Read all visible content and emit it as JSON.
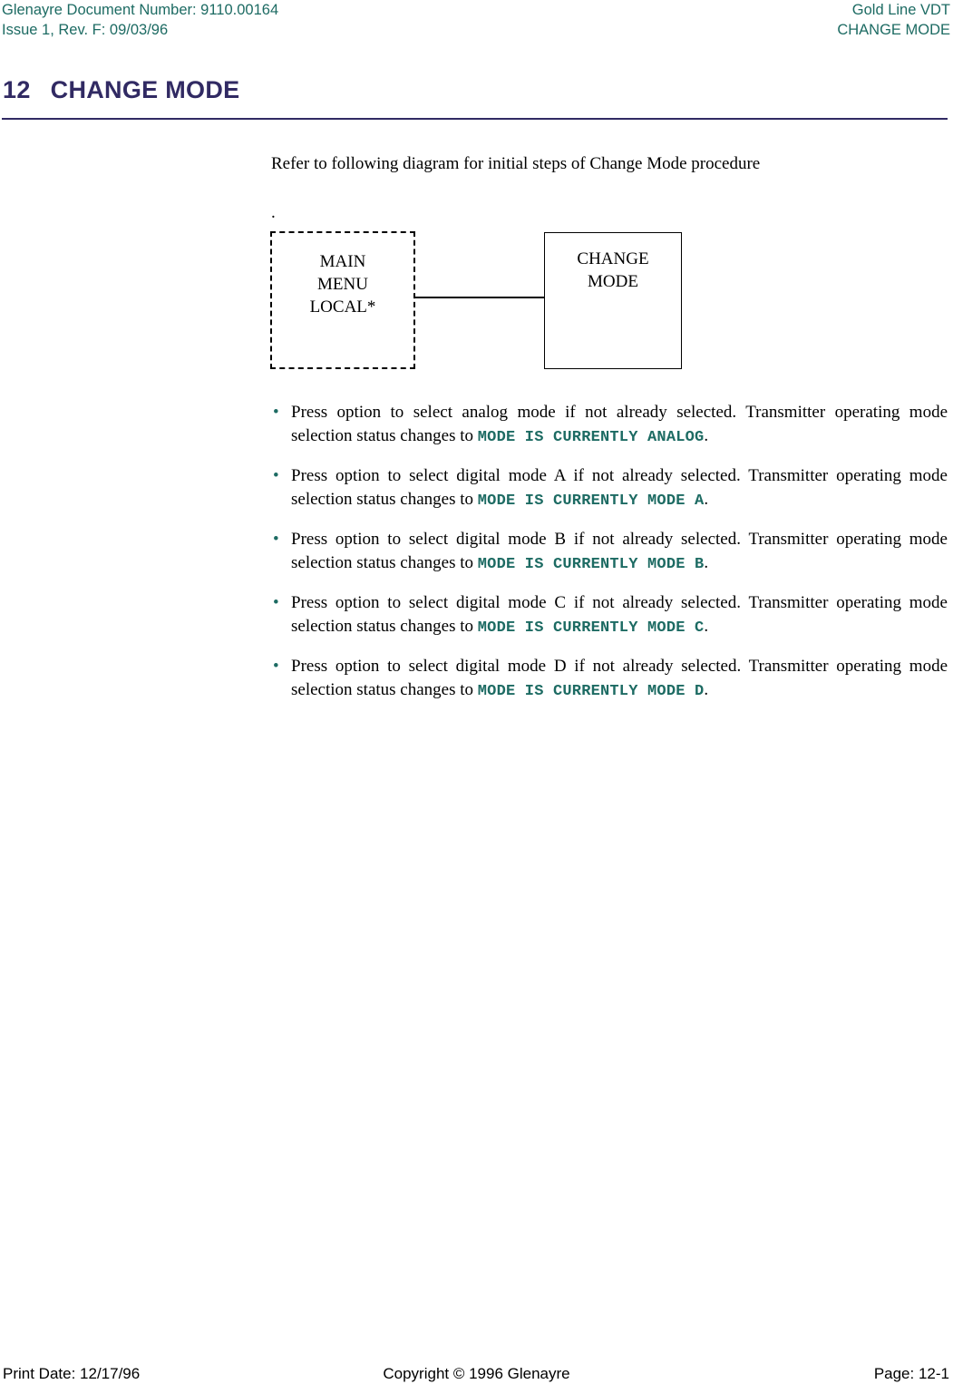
{
  "header": {
    "left_line1": "Glenayre Document Number: 9110.00164",
    "left_line2": "Issue 1, Rev. F: 09/03/96",
    "right_line1": "Gold Line VDT",
    "right_line2": "CHANGE MODE",
    "color": "#1d6b63"
  },
  "title": {
    "number": "12",
    "text": "CHANGE MODE",
    "color": "#312a63"
  },
  "intro": {
    "paragraph": "Refer to following diagram for initial steps of Change Mode procedure",
    "stray_period": "."
  },
  "diagram": {
    "source_node": {
      "line1": "MAIN",
      "line2": "MENU",
      "line3": "LOCAL*",
      "border_style": "dashed"
    },
    "target_node": {
      "line1": "CHANGE",
      "line2": "MODE",
      "border_style": "solid"
    }
  },
  "bullets": [
    {
      "marker": "•",
      "text_before": "Press option to select analog mode if not already selected. Transmitter operating mode selection status changes to ",
      "code": "MODE IS CURRENTLY ANALOG",
      "text_after": "."
    },
    {
      "marker": "•",
      "text_before": "Press option to select digital mode A if not already selected. Transmitter operating mode selection status changes to ",
      "code": "MODE IS CURRENTLY MODE A",
      "text_after": "."
    },
    {
      "marker": "•",
      "text_before": "Press option to select digital mode B if not already selected. Transmitter operating mode selection status changes to ",
      "code": "MODE IS CURRENTLY MODE B",
      "text_after": "."
    },
    {
      "marker": "•",
      "text_before": "Press option to select digital mode C if not already selected. Transmitter operating mode selection status changes to ",
      "code": "MODE IS CURRENTLY MODE C",
      "text_after": "."
    },
    {
      "marker": "•",
      "text_before": "Press option to select digital mode D if not already selected. Transmitter operating mode selection status changes to ",
      "code": "MODE IS CURRENTLY MODE D",
      "text_after": "."
    }
  ],
  "footer": {
    "left": "Print Date: 12/17/96",
    "center": "Copyright © 1996 Glenayre",
    "right": "Page: 12-1"
  }
}
